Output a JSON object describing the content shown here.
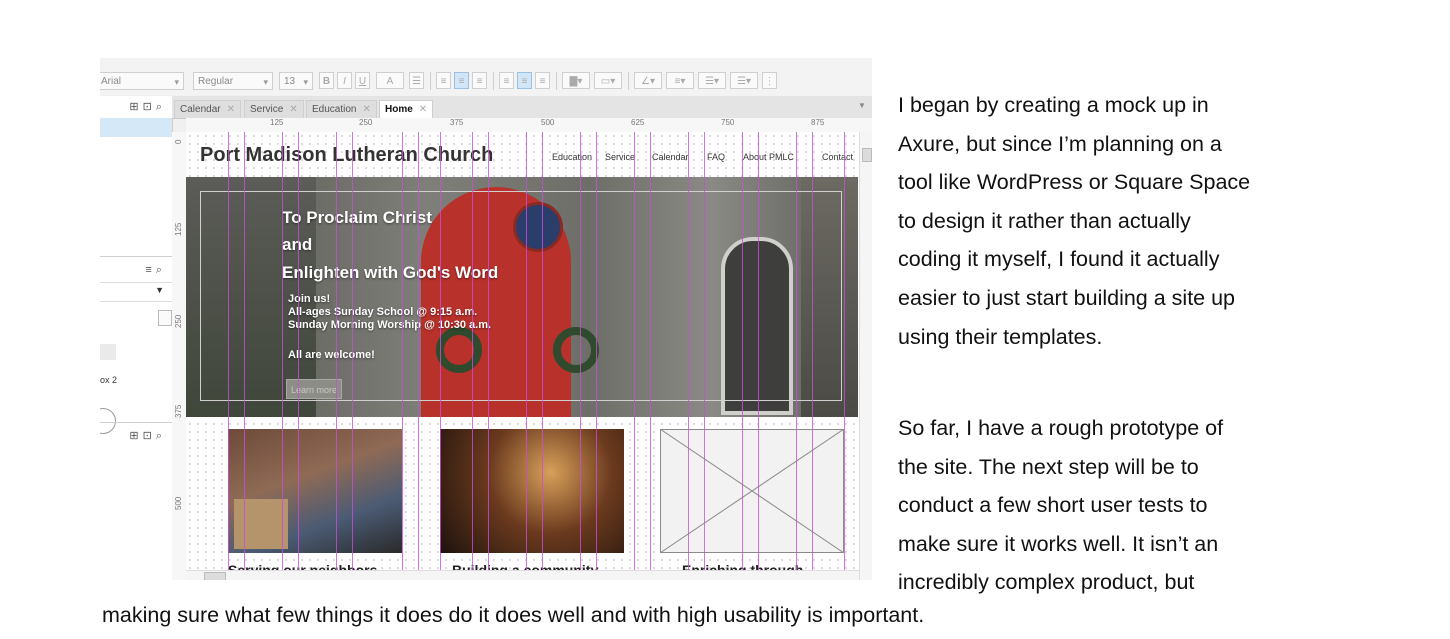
{
  "axure": {
    "toolbar": {
      "font_family": "Arial",
      "font_style": "Regular",
      "font_size": "13",
      "bold": "B",
      "italic": "I",
      "underline": "U",
      "font_color": "A"
    },
    "tabs": [
      {
        "label": "Calendar",
        "active": false
      },
      {
        "label": "Service",
        "active": false
      },
      {
        "label": "Education",
        "active": false
      },
      {
        "label": "Home",
        "active": true
      }
    ],
    "ruler_h": [
      "125",
      "250",
      "375",
      "500",
      "625",
      "750",
      "875"
    ],
    "ruler_v": [
      "0",
      "125",
      "250",
      "375",
      "500"
    ],
    "left_panel": {
      "item_label": "ox 2"
    },
    "mockup": {
      "site_title": "Port Madison Lutheran Church",
      "nav": [
        "Education",
        "Service",
        "Calendar",
        "FAQ",
        "About PMLC",
        "Contact"
      ],
      "hero": {
        "heading_lines": [
          "To Proclaim Christ",
          "and",
          "Enlighten with God's Word"
        ],
        "body_lines": [
          "Join us!",
          "All-ages Sunday School @ 9:15 a.m.",
          "Sunday Morning Worship @ 10:30 a.m."
        ],
        "welcome": "All are welcome!",
        "button": "Learn more"
      },
      "cards": [
        {
          "caption": "Serving our neighbors"
        },
        {
          "caption": "Building a community"
        },
        {
          "caption": "Enriching through"
        }
      ]
    },
    "colors": {
      "guide": "#c84fd8",
      "door_red": "#b8312b"
    }
  },
  "text": {
    "para1": [
      "I began by creating a mock up in",
      "Axure, but since I’m planning on a",
      "tool like WordPress or Square Space",
      "to design it rather than actually",
      "coding it myself, I found it actually",
      "easier to just start building a site up",
      "using their templates."
    ],
    "para2": [
      "So far, I have a rough prototype of",
      "the site.  The next step will be to",
      "conduct a few short user tests to",
      "make sure it works well.  It isn’t an",
      "incredibly complex product, but"
    ],
    "tail": "making sure what few things it does do it does well and with high usability is important."
  }
}
